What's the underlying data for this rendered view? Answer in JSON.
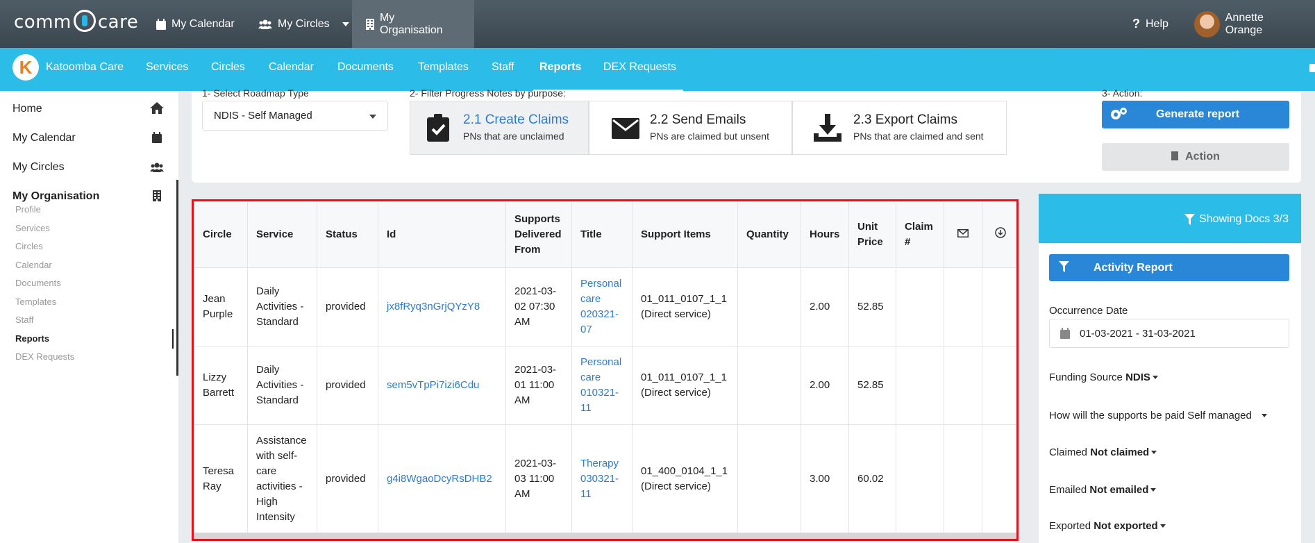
{
  "topbar": {
    "logo_left": "comm",
    "logo_right": "care",
    "nav": [
      "My Calendar",
      "My Circles",
      "My Organisation"
    ],
    "help": "Help",
    "user": "Annette Orange"
  },
  "orgbar": {
    "org_name": "Katoomba Care",
    "items": [
      "Services",
      "Circles",
      "Calendar",
      "Documents",
      "Templates",
      "Staff",
      "Reports",
      "DEX Requests"
    ]
  },
  "sidebar": {
    "main": [
      "Home",
      "My Calendar",
      "My Circles",
      "My Organisation"
    ],
    "sub": [
      "Profile",
      "Services",
      "Circles",
      "Calendar",
      "Documents",
      "Templates",
      "Staff",
      "Reports",
      "DEX Requests"
    ]
  },
  "steps": {
    "label1": "1- Select Roadmap Type",
    "roadmap_value": "NDIS - Self Managed",
    "label2": "2- Filter Progress Notes by purpose:",
    "step1_title": "2.1 Create Claims",
    "step1_sub": "PNs that are unclaimed",
    "step2_title": "2.2 Send Emails",
    "step2_sub": "PNs are claimed but unsent",
    "step3_title": "2.3 Export Claims",
    "step3_sub": "PNs that are claimed and sent",
    "label3": "3- Action:",
    "generate": "Generate report",
    "action": "Action"
  },
  "table": {
    "headers": [
      "Circle",
      "Service",
      "Status",
      "Id",
      "Supports Delivered From",
      "Title",
      "Support Items",
      "Quantity",
      "Hours",
      "Unit Price",
      "Claim #"
    ],
    "rows": [
      {
        "circle": "Jean Purple",
        "service": "Daily Activities - Standard",
        "status": "provided",
        "id": "jx8fRyq3nGrjQYzY8",
        "from": "2021-03-02 07:30 AM",
        "title": "Personal care 020321-07",
        "items": "01_011_0107_1_1 (Direct service)",
        "quantity": "",
        "hours": "2.00",
        "price": "52.85",
        "claim": ""
      },
      {
        "circle": "Lizzy Barrett",
        "service": "Daily Activities - Standard",
        "status": "provided",
        "id": "sem5vTpPi7izi6Cdu",
        "from": "2021-03-01 11:00 AM",
        "title": "Personal care 010321-11",
        "items": "01_011_0107_1_1 (Direct service)",
        "quantity": "",
        "hours": "2.00",
        "price": "52.85",
        "claim": ""
      },
      {
        "circle": "Teresa Ray",
        "service": "Assistance with self-care activities - High Intensity",
        "status": "provided",
        "id": "g4i8WgaoDcyRsDHB2",
        "from": "2021-03-03 11:00 AM",
        "title": "Therapy 030321-11",
        "items": "01_400_0104_1_1 (Direct service)",
        "quantity": "",
        "hours": "3.00",
        "price": "60.02",
        "claim": ""
      }
    ]
  },
  "filters": {
    "showing": "Showing Docs 3/3",
    "activity_report": "Activity Report",
    "occurrence_label": "Occurrence Date",
    "occurrence_value": "01-03-2021 - 31-03-2021",
    "funding_label": "Funding Source",
    "funding_value": "NDIS",
    "paid_label": "How will the supports be paid",
    "paid_value": "Self managed",
    "claimed_label": "Claimed",
    "claimed_value": "Not claimed",
    "emailed_label": "Emailed",
    "emailed_value": "Not emailed",
    "exported_label": "Exported",
    "exported_value": "Not exported"
  },
  "colors": {
    "topbar": "#45525b",
    "accent": "#2bbde8",
    "primary_button": "#2a87d8",
    "link": "#2c7bd0",
    "highlight": "#e8111b"
  }
}
